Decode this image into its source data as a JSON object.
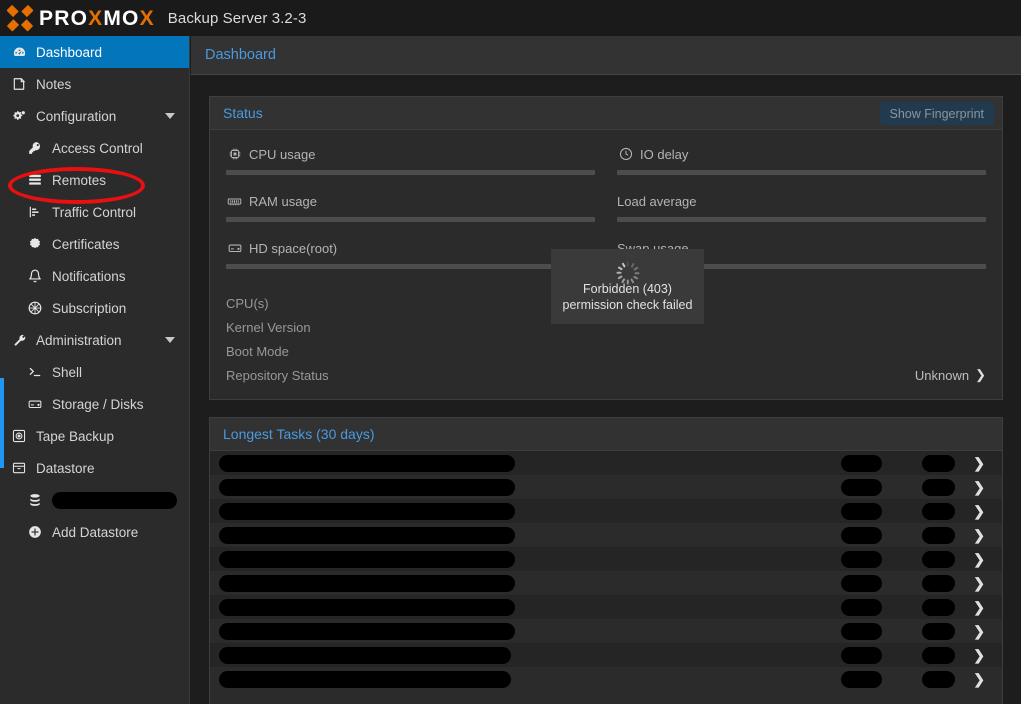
{
  "topbar": {
    "logo_part1": "PRO",
    "logo_x": "X",
    "logo_part2": "MO",
    "logo_x2": "X",
    "product_title": "Backup Server 3.2-3",
    "logo_icon": "proxmox-x-logo"
  },
  "breadcrumb": {
    "text": "Dashboard"
  },
  "sidebar": {
    "items": [
      {
        "label": "Dashboard",
        "icon": "dashboard-icon",
        "level": 0,
        "selected": true,
        "expandable": false,
        "redacted": false
      },
      {
        "label": "Notes",
        "icon": "note-icon",
        "level": 0,
        "selected": false,
        "expandable": false,
        "redacted": false
      },
      {
        "label": "Configuration",
        "icon": "gears-icon",
        "level": 0,
        "selected": false,
        "expandable": true,
        "redacted": false
      },
      {
        "label": "Access Control",
        "icon": "key-icon",
        "level": 1,
        "selected": false,
        "expandable": false,
        "redacted": false
      },
      {
        "label": "Remotes",
        "icon": "server-rack-icon",
        "level": 1,
        "selected": false,
        "expandable": false,
        "redacted": false
      },
      {
        "label": "Traffic Control",
        "icon": "bar-chart-icon",
        "level": 1,
        "selected": false,
        "expandable": false,
        "redacted": false
      },
      {
        "label": "Certificates",
        "icon": "certificate-icon",
        "level": 1,
        "selected": false,
        "expandable": false,
        "redacted": false
      },
      {
        "label": "Notifications",
        "icon": "bell-icon",
        "level": 1,
        "selected": false,
        "expandable": false,
        "redacted": false
      },
      {
        "label": "Subscription",
        "icon": "ticket-icon",
        "level": 1,
        "selected": false,
        "expandable": false,
        "redacted": false
      },
      {
        "label": "Administration",
        "icon": "wrench-icon",
        "level": 0,
        "selected": false,
        "expandable": true,
        "redacted": false
      },
      {
        "label": "Shell",
        "icon": "terminal-icon",
        "level": 1,
        "selected": false,
        "expandable": false,
        "redacted": false
      },
      {
        "label": "Storage / Disks",
        "icon": "hdd-icon",
        "level": 1,
        "selected": false,
        "expandable": false,
        "redacted": false
      },
      {
        "label": "Tape Backup",
        "icon": "tape-icon",
        "level": 0,
        "selected": false,
        "expandable": false,
        "redacted": false
      },
      {
        "label": "Datastore",
        "icon": "archive-icon",
        "level": 0,
        "selected": false,
        "expandable": false,
        "redacted": false
      },
      {
        "label": "",
        "icon": "database-icon",
        "level": 1,
        "selected": false,
        "expandable": false,
        "redacted": true,
        "redact_width": 125
      },
      {
        "label": "Add Datastore",
        "icon": "plus-circle-icon",
        "level": 1,
        "selected": false,
        "expandable": false,
        "redacted": false
      }
    ],
    "annotation": {
      "shape": "ellipse",
      "color": "#e81010",
      "target": "Access Control"
    },
    "scrollbar_color": "#2196f3"
  },
  "status_panel": {
    "title": "Status",
    "show_fingerprint_label": "Show Fingerprint",
    "gauges_left": [
      {
        "label": "CPU usage",
        "icon": "cpu-icon",
        "value": "",
        "percent": 0
      },
      {
        "label": "RAM usage",
        "icon": "ram-icon",
        "value": "",
        "percent": 0
      },
      {
        "label": "HD space(root)",
        "icon": "hdd-icon",
        "value": "",
        "percent": 0
      }
    ],
    "gauges_right": [
      {
        "label": "IO delay",
        "icon": "clock-icon",
        "value": "",
        "percent": 0
      },
      {
        "label": "Load average",
        "icon": "",
        "value": "",
        "percent": 0
      },
      {
        "label": "Swap usage",
        "icon": "",
        "value": "",
        "percent": 0
      }
    ],
    "details": [
      {
        "key": "CPU(s)",
        "value": ""
      },
      {
        "key": "Kernel Version",
        "value": ""
      },
      {
        "key": "Boot Mode",
        "value": ""
      },
      {
        "key": "Repository Status",
        "value": "Unknown",
        "chevron": "❯"
      }
    ]
  },
  "error_overlay": {
    "icon": "loading-spinner-icon",
    "line1": "Forbidden (403)",
    "line2": "permission check failed"
  },
  "tasks_panel": {
    "title": "Longest Tasks (30 days)",
    "chevron": "❯",
    "rows": [
      {
        "name_width": 296,
        "redacted": true
      },
      {
        "name_width": 296,
        "redacted": true
      },
      {
        "name_width": 296,
        "redacted": true
      },
      {
        "name_width": 296,
        "redacted": true
      },
      {
        "name_width": 296,
        "redacted": true
      },
      {
        "name_width": 296,
        "redacted": true
      },
      {
        "name_width": 296,
        "redacted": true
      },
      {
        "name_width": 296,
        "redacted": true
      },
      {
        "name_width": 292,
        "redacted": true
      },
      {
        "name_width": 292,
        "redacted": true
      }
    ]
  }
}
